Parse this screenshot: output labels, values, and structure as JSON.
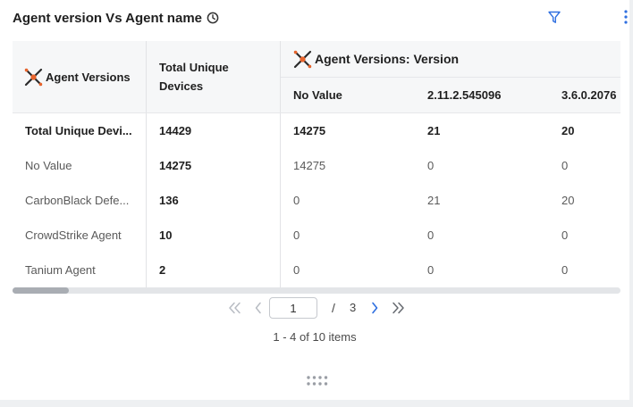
{
  "widget": {
    "title": "Agent version Vs Agent name"
  },
  "table": {
    "row_header_label": "Agent Versions",
    "total_col_label_line1": "Total Unique",
    "total_col_label_line2": "Devices",
    "group_header_label": "Agent Versions: Version",
    "version_columns": [
      "No Value",
      "2.11.2.545096",
      "3.6.0.2076"
    ],
    "rows": [
      {
        "name": "Total Unique Devi...",
        "total": "14429",
        "values": [
          "14275",
          "21",
          "20"
        ],
        "bold": true
      },
      {
        "name": "No Value",
        "total": "14275",
        "values": [
          "14275",
          "0",
          "0"
        ],
        "bold": false
      },
      {
        "name": "CarbonBlack Defe...",
        "total": "136",
        "values": [
          "0",
          "21",
          "20"
        ],
        "bold": false
      },
      {
        "name": "CrowdStrike Agent",
        "total": "10",
        "values": [
          "0",
          "0",
          "0"
        ],
        "bold": false
      },
      {
        "name": "Tanium Agent",
        "total": "2",
        "values": [
          "0",
          "0",
          "0"
        ],
        "bold": false
      }
    ]
  },
  "pagination": {
    "current_page": "1",
    "slash": "/",
    "total_pages": "3",
    "summary": "1 - 4 of 10 items"
  },
  "colors": {
    "accent": "#2f6fe0",
    "icon_orange": "#e8642c",
    "icon_dark": "#2b2b2b",
    "disabled": "#b8bcc3"
  },
  "icons": {
    "clock": "clock-icon",
    "filter": "filter-icon",
    "kebab": "kebab-menu-icon",
    "pivot": "pivot-icon",
    "first": "first-page-icon",
    "prev": "prev-page-icon",
    "next": "next-page-icon",
    "last": "last-page-icon",
    "drag": "drag-handle-icon"
  }
}
